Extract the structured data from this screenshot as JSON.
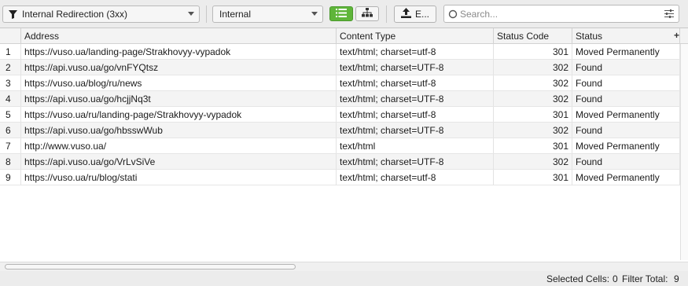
{
  "toolbar": {
    "filter_value": "Internal Redirection (3xx)",
    "scope_value": "Internal",
    "export_label": "E...",
    "search_placeholder": "Search..."
  },
  "table": {
    "columns": [
      "Address",
      "Content Type",
      "Status Code",
      "Status"
    ],
    "rows": [
      {
        "n": "1",
        "address": "https://vuso.ua/landing-page/Strakhovyy-vypadok",
        "content_type": "text/html; charset=utf-8",
        "status_code": "301",
        "status": "Moved Permanently"
      },
      {
        "n": "2",
        "address": "https://api.vuso.ua/go/vnFYQtsz",
        "content_type": "text/html; charset=UTF-8",
        "status_code": "302",
        "status": "Found"
      },
      {
        "n": "3",
        "address": "https://vuso.ua/blog/ru/news",
        "content_type": "text/html; charset=utf-8",
        "status_code": "302",
        "status": "Found"
      },
      {
        "n": "4",
        "address": "https://api.vuso.ua/go/hcjjNq3t",
        "content_type": "text/html; charset=UTF-8",
        "status_code": "302",
        "status": "Found"
      },
      {
        "n": "5",
        "address": "https://vuso.ua/ru/landing-page/Strakhovyy-vypadok",
        "content_type": "text/html; charset=utf-8",
        "status_code": "301",
        "status": "Moved Permanently"
      },
      {
        "n": "6",
        "address": "https://api.vuso.ua/go/hbsswWub",
        "content_type": "text/html; charset=UTF-8",
        "status_code": "302",
        "status": "Found"
      },
      {
        "n": "7",
        "address": "http://www.vuso.ua/",
        "content_type": "text/html",
        "status_code": "301",
        "status": "Moved Permanently"
      },
      {
        "n": "8",
        "address": "https://api.vuso.ua/go/VrLvSiVe",
        "content_type": "text/html; charset=UTF-8",
        "status_code": "302",
        "status": "Found"
      },
      {
        "n": "9",
        "address": "https://vuso.ua/ru/blog/stati",
        "content_type": "text/html; charset=utf-8",
        "status_code": "301",
        "status": "Moved Permanently"
      }
    ]
  },
  "statusbar": {
    "selected_label": "Selected Cells:",
    "selected_value": "0",
    "filter_label": "Filter Total:",
    "filter_value": "9"
  },
  "colors": {
    "accent_green": "#5fb53a"
  },
  "icons": [
    "filter-icon",
    "chevron-down-icon",
    "list-view-icon",
    "tree-view-icon",
    "export-icon",
    "search-icon",
    "filter-settings-icon",
    "add-column-icon"
  ]
}
